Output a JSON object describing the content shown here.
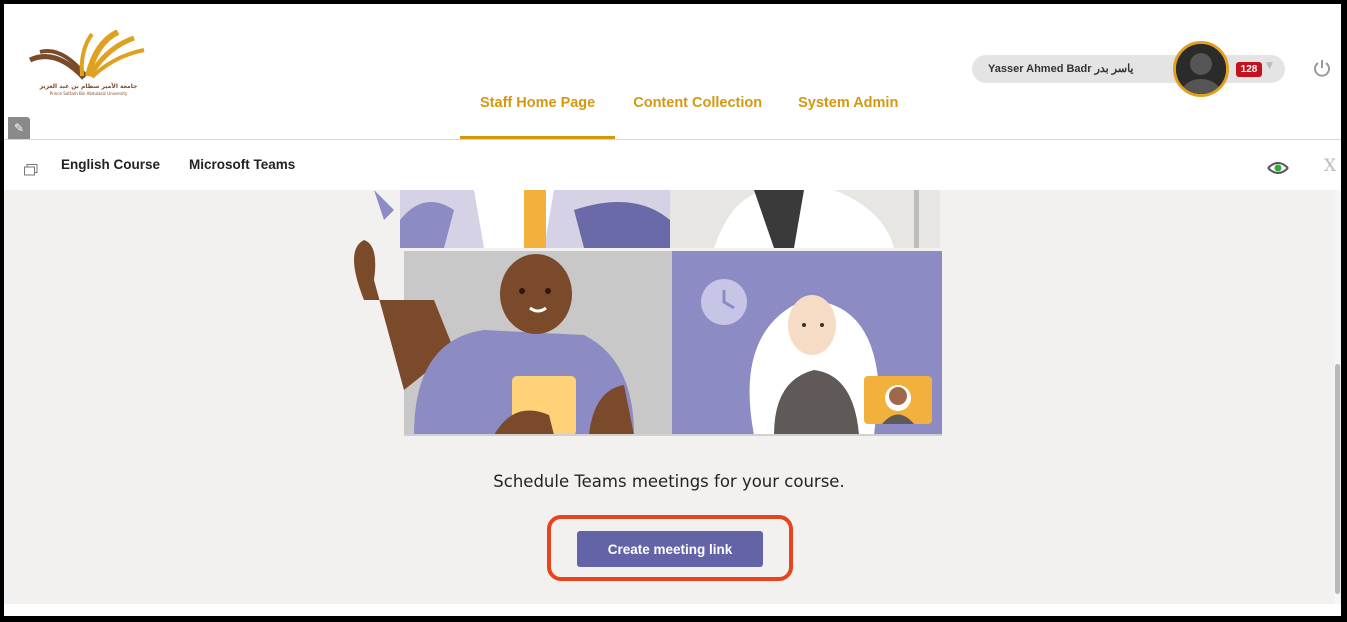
{
  "header": {
    "logo": {
      "arabic_name": "جامعة الأمير سطام بن عبد العزيز",
      "english_name": "Prince Sattam Bin Abdulaziz University",
      "icon": "university-logo"
    },
    "pin_icon": "pin-icon",
    "tabs": [
      {
        "label": "Staff Home Page",
        "active": true
      },
      {
        "label": "Content Collection",
        "active": false
      },
      {
        "label": "System Admin",
        "active": false
      }
    ],
    "user": {
      "name": "Yasser Ahmed Badr ياسر بدر",
      "notifications": "128"
    },
    "power_icon": "power-icon"
  },
  "breadcrumb": {
    "items": [
      "English Course",
      "Microsoft Teams"
    ]
  },
  "main": {
    "message": "Schedule Teams meetings for your course.",
    "button_label": "Create meeting link"
  },
  "colors": {
    "accent": "#d4980f",
    "teams_purple": "#6264a7",
    "highlight": "#e8431d",
    "badge": "#c4121e"
  }
}
